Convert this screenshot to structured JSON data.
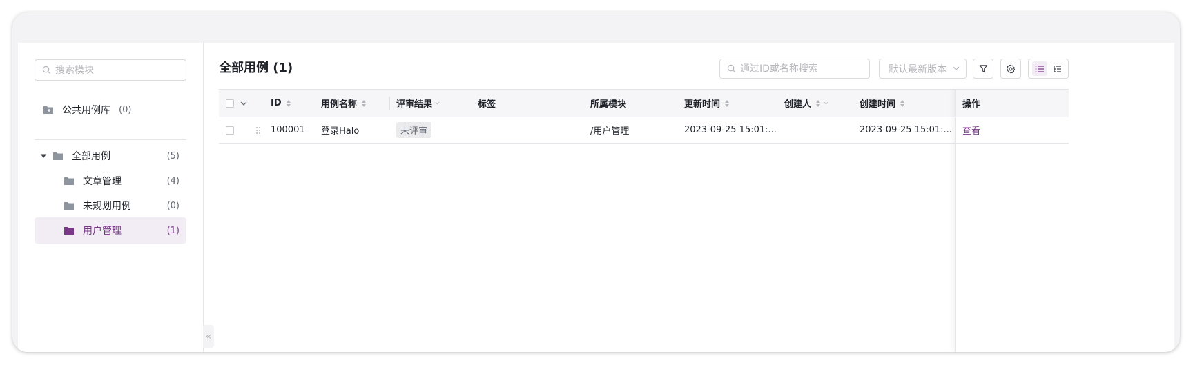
{
  "sidebar": {
    "search_placeholder": "搜索模块",
    "public": {
      "label": "公共用例库",
      "count": "(0)"
    },
    "tree": [
      {
        "label": "全部用例",
        "count": "(5)"
      },
      {
        "label": "文章管理",
        "count": "(4)"
      },
      {
        "label": "未规划用例",
        "count": "(0)"
      },
      {
        "label": "用户管理",
        "count": "(1)"
      }
    ],
    "collapse_glyph": "«"
  },
  "main": {
    "title": "全部用例 (1)",
    "search_placeholder": "通过ID或名称搜索",
    "version_placeholder": "默认最新版本"
  },
  "table": {
    "columns": [
      "ID",
      "用例名称",
      "评审结果",
      "标签",
      "所属模块",
      "更新时间",
      "创建人",
      "创建时间",
      "操作"
    ],
    "rows": [
      {
        "id": "100001",
        "name": "登录Halo",
        "review": "未评审",
        "tags": "",
        "module": "/用户管理",
        "updated": "2023-09-25 15:01:...",
        "creator": "",
        "created": "2023-09-25 15:01:...",
        "action": "查看"
      }
    ]
  },
  "colors": {
    "accent": "#783887",
    "active_bg": "#f2edf4",
    "folder": "#8f959e"
  },
  "icons": [
    "search-icon",
    "folder-icon",
    "caret-down-icon",
    "filter-icon",
    "gear-icon",
    "list-view-icon",
    "tree-view-icon",
    "drag-handle-icon",
    "sort-icon",
    "chevron-down-icon"
  ]
}
